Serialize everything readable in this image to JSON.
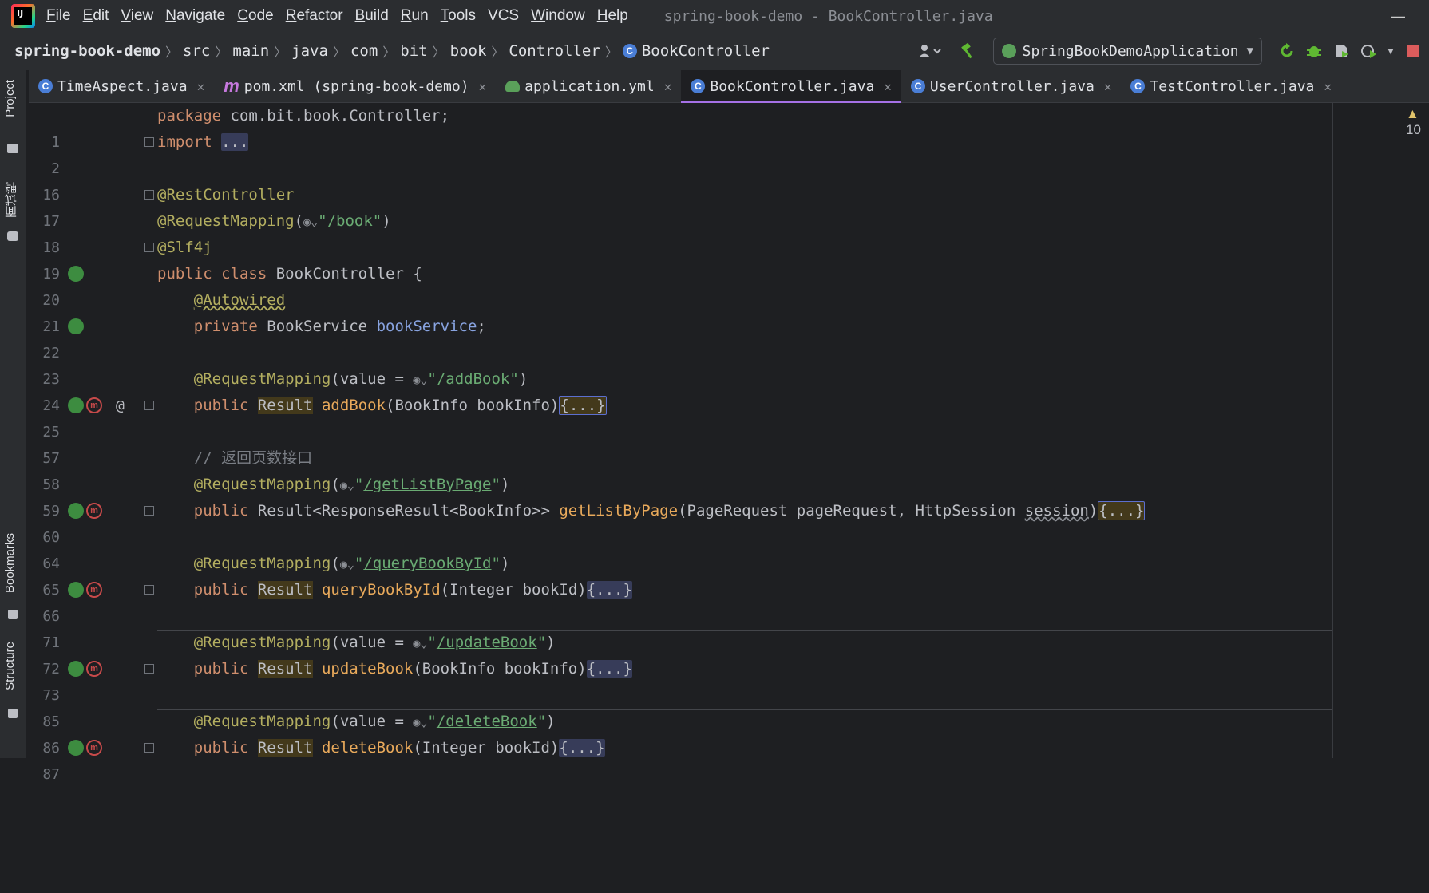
{
  "app": {
    "logo_text": "IJ",
    "window_title": "spring-book-demo - BookController.java",
    "minimize": "—"
  },
  "menu": [
    {
      "key": "F",
      "rest": "ile"
    },
    {
      "key": "E",
      "rest": "dit"
    },
    {
      "key": "V",
      "rest": "iew"
    },
    {
      "key": "N",
      "rest": "avigate"
    },
    {
      "key": "C",
      "rest": "ode"
    },
    {
      "key": "R",
      "rest": "efactor"
    },
    {
      "key": "B",
      "rest": "uild"
    },
    {
      "key": "R",
      "rest": "un"
    },
    {
      "key": "T",
      "rest": "ools"
    },
    {
      "key": "",
      "rest": "VCS"
    },
    {
      "key": "W",
      "rest": "indow"
    },
    {
      "key": "H",
      "rest": "elp"
    }
  ],
  "breadcrumb": [
    "spring-book-demo",
    "src",
    "main",
    "java",
    "com",
    "bit",
    "book",
    "Controller",
    "BookController"
  ],
  "toolbar": {
    "run_config": "SpringBookDemoApplication"
  },
  "tabs": [
    {
      "label": "TimeAspect.java",
      "icon": "class-icon"
    },
    {
      "label": "pom.xml (spring-book-demo)",
      "icon": "maven-icon"
    },
    {
      "label": "application.yml",
      "icon": "yml-icon"
    },
    {
      "label": "BookController.java",
      "icon": "class-icon",
      "active": true
    },
    {
      "label": "UserController.java",
      "icon": "class-icon"
    },
    {
      "label": "TestController.java",
      "icon": "class-icon"
    }
  ],
  "side_tools": {
    "project": "Project",
    "interview": "面试鸭",
    "bookmarks": "Bookmarks",
    "structure": "Structure"
  },
  "editor": {
    "warnings": "10",
    "line_numbers": [
      "1",
      "2",
      "16",
      "17",
      "18",
      "19",
      "20",
      "21",
      "22",
      "23",
      "24",
      "25",
      "57",
      "58",
      "59",
      "60",
      "64",
      "65",
      "66",
      "71",
      "72",
      "73",
      "85",
      "86",
      "87"
    ],
    "code": {
      "pkg_kw": "package",
      "pkg_name": " com.bit.book.Controller;",
      "import_kw": "import",
      "folded": "...",
      "rest_controller": "@RestController",
      "req_mapping": "@RequestMapping",
      "book_url": "/book",
      "slf4j": "@Slf4j",
      "public": "public",
      "class": "class",
      "class_name": " BookController {",
      "autowired": "@Autowired",
      "private": "private",
      "book_service_type": " BookService ",
      "book_service_field": "bookService",
      "value_eq": "value = ",
      "add_url": "/addBook",
      "result": "Result",
      "add_fn": "addBook",
      "add_params": "(BookInfo bookInfo)",
      "fold_body": "{...}",
      "comment": "// 返回页数接口",
      "list_url": "/getListByPage",
      "list_ret": " Result<ResponseResult<BookInfo>> ",
      "list_fn": "getListByPage",
      "list_params": "(PageRequest pageRequest, HttpSession ",
      "session": "session",
      "query_url": "/queryBookById",
      "query_fn": "queryBookById",
      "query_params": "(Integer bookId)",
      "update_url": "/updateBook",
      "update_fn": "updateBook",
      "update_params": "(BookInfo bookInfo)",
      "delete_url": "/deleteBook",
      "delete_fn": "deleteBook",
      "delete_params": "(Integer bookId)"
    }
  }
}
